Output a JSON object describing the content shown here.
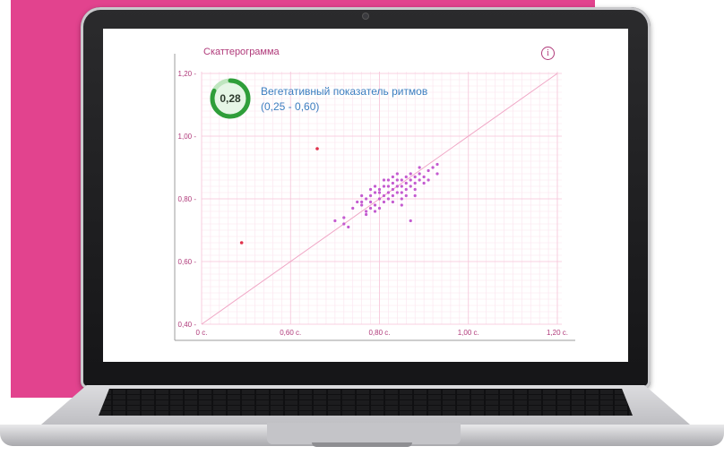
{
  "chart_data": {
    "type": "scatter",
    "title": "Скаттерограмма",
    "info_icon": "info-icon",
    "x_ticks": [
      "0 c.",
      "0,60 c.",
      "0,80 c.",
      "1,00 c.",
      "1,20 c."
    ],
    "y_ticks": [
      "0,40",
      "0,60",
      "0,80",
      "1,00",
      "1,20"
    ],
    "xlim": [
      0.4,
      1.2
    ],
    "ylim": [
      0.4,
      1.2
    ],
    "diagonal": true,
    "grid": true,
    "point_color": "#c45bd0",
    "outlier_color": "#e0314b",
    "outliers": [
      {
        "x": 0.49,
        "y": 0.66
      },
      {
        "x": 0.66,
        "y": 0.96
      }
    ],
    "points": [
      {
        "x": 0.74,
        "y": 0.77
      },
      {
        "x": 0.75,
        "y": 0.79
      },
      {
        "x": 0.76,
        "y": 0.78
      },
      {
        "x": 0.77,
        "y": 0.8
      },
      {
        "x": 0.78,
        "y": 0.79
      },
      {
        "x": 0.78,
        "y": 0.81
      },
      {
        "x": 0.79,
        "y": 0.82
      },
      {
        "x": 0.79,
        "y": 0.78
      },
      {
        "x": 0.8,
        "y": 0.8
      },
      {
        "x": 0.8,
        "y": 0.83
      },
      {
        "x": 0.81,
        "y": 0.81
      },
      {
        "x": 0.81,
        "y": 0.84
      },
      {
        "x": 0.82,
        "y": 0.82
      },
      {
        "x": 0.82,
        "y": 0.8
      },
      {
        "x": 0.83,
        "y": 0.83
      },
      {
        "x": 0.83,
        "y": 0.85
      },
      {
        "x": 0.84,
        "y": 0.82
      },
      {
        "x": 0.84,
        "y": 0.86
      },
      {
        "x": 0.85,
        "y": 0.84
      },
      {
        "x": 0.85,
        "y": 0.82
      },
      {
        "x": 0.86,
        "y": 0.85
      },
      {
        "x": 0.86,
        "y": 0.87
      },
      {
        "x": 0.87,
        "y": 0.86
      },
      {
        "x": 0.87,
        "y": 0.84
      },
      {
        "x": 0.88,
        "y": 0.87
      },
      {
        "x": 0.88,
        "y": 0.85
      },
      {
        "x": 0.89,
        "y": 0.88
      },
      {
        "x": 0.89,
        "y": 0.86
      },
      {
        "x": 0.9,
        "y": 0.87
      },
      {
        "x": 0.91,
        "y": 0.89
      },
      {
        "x": 0.92,
        "y": 0.9
      },
      {
        "x": 0.93,
        "y": 0.88
      },
      {
        "x": 0.83,
        "y": 0.79
      },
      {
        "x": 0.8,
        "y": 0.77
      },
      {
        "x": 0.77,
        "y": 0.76
      },
      {
        "x": 0.85,
        "y": 0.8
      },
      {
        "x": 0.79,
        "y": 0.84
      },
      {
        "x": 0.82,
        "y": 0.86
      },
      {
        "x": 0.84,
        "y": 0.88
      },
      {
        "x": 0.86,
        "y": 0.83
      },
      {
        "x": 0.88,
        "y": 0.83
      },
      {
        "x": 0.81,
        "y": 0.79
      },
      {
        "x": 0.78,
        "y": 0.77
      },
      {
        "x": 0.76,
        "y": 0.81
      },
      {
        "x": 0.83,
        "y": 0.81
      },
      {
        "x": 0.85,
        "y": 0.86
      },
      {
        "x": 0.87,
        "y": 0.88
      },
      {
        "x": 0.9,
        "y": 0.85
      },
      {
        "x": 0.82,
        "y": 0.84
      },
      {
        "x": 0.8,
        "y": 0.82
      },
      {
        "x": 0.84,
        "y": 0.84
      },
      {
        "x": 0.86,
        "y": 0.81
      },
      {
        "x": 0.72,
        "y": 0.72
      },
      {
        "x": 0.73,
        "y": 0.71
      },
      {
        "x": 0.72,
        "y": 0.74
      },
      {
        "x": 0.7,
        "y": 0.73
      },
      {
        "x": 0.77,
        "y": 0.75
      },
      {
        "x": 0.79,
        "y": 0.76
      },
      {
        "x": 0.87,
        "y": 0.73
      },
      {
        "x": 0.93,
        "y": 0.91
      },
      {
        "x": 0.91,
        "y": 0.86
      },
      {
        "x": 0.89,
        "y": 0.9
      },
      {
        "x": 0.81,
        "y": 0.86
      },
      {
        "x": 0.83,
        "y": 0.87
      },
      {
        "x": 0.78,
        "y": 0.83
      },
      {
        "x": 0.76,
        "y": 0.79
      },
      {
        "x": 0.88,
        "y": 0.81
      },
      {
        "x": 0.85,
        "y": 0.78
      }
    ]
  },
  "metric": {
    "value": "0,28",
    "value_fraction": 0.82,
    "label": "Вегетативный показатель ритмов",
    "range": "(0,25 - 0,60)",
    "gauge_color": "#2f9e3a"
  },
  "brand": {
    "accent": "#e2438e"
  }
}
